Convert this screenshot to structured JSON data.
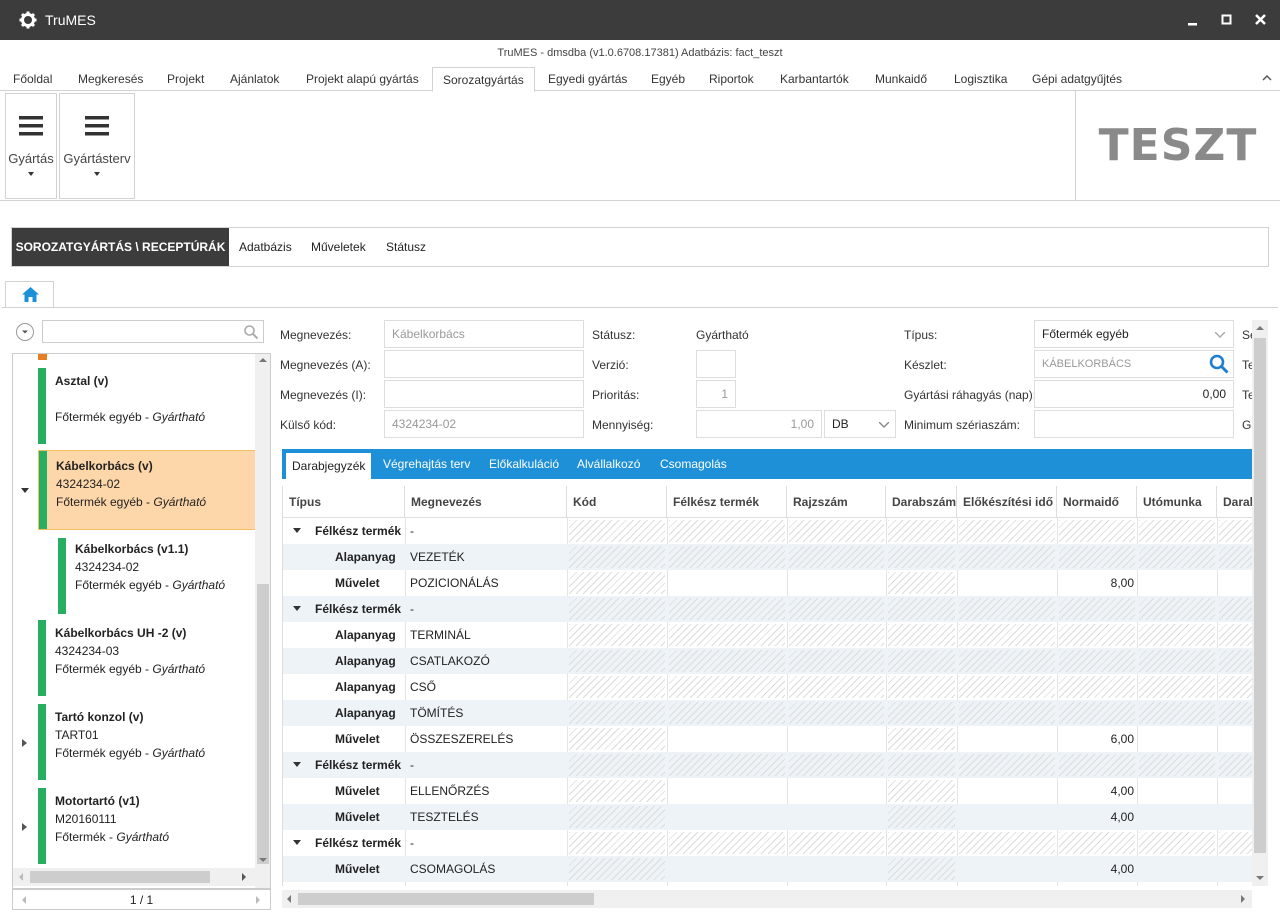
{
  "window": {
    "title": "TruMES",
    "subtitle": "TruMES - dmsdba (v1.0.6708.17381) Adatbázis: fact_teszt"
  },
  "menu_tabs": [
    "Főoldal",
    "Megkeresés",
    "Projekt",
    "Ajánlatok",
    "Projekt alapú gyártás",
    "Sorozatgyártás",
    "Egyedi gyártás",
    "Egyéb",
    "Riportok",
    "Karbantartók",
    "Munkaidő",
    "Logisztika",
    "Gépi adatgyűjtés"
  ],
  "active_menu_tab": "Sorozatgyártás",
  "ribbon": {
    "buttons": [
      "Gyártás",
      "Gyártásterv"
    ],
    "environment_label": "TESZT"
  },
  "module": {
    "breadcrumb": "SOROZATGYÁRTÁS \\ RECEPTÚRÁK",
    "items": [
      "Adatbázis",
      "Műveletek",
      "Státusz"
    ]
  },
  "tree": {
    "search_placeholder": "",
    "nodes": [
      {
        "title": "Asztal  (v)",
        "code": "",
        "type": "Főtermék egyéb",
        "status": "Gyártható"
      },
      {
        "title": "Kábelkorbács  (v)",
        "code": "4324234-02",
        "type": "Főtermék egyéb",
        "status": "Gyártható"
      },
      {
        "title": "Kábelkorbács  (v1.1)",
        "code": "4324234-02",
        "type": "Főtermék egyéb",
        "status": "Gyártható"
      },
      {
        "title": "Kábelkorbács UH -2  (v)",
        "code": "4324234-03",
        "type": "Főtermék egyéb",
        "status": "Gyártható"
      },
      {
        "title": "Tartó konzol  (v)",
        "code": "TART01",
        "type": "Főtermék egyéb",
        "status": "Gyártható"
      },
      {
        "title": "Motortartó  (v1)",
        "code": "M20160111",
        "type": "Főtermék",
        "status": "Gyártható"
      }
    ],
    "pager": "1 / 1"
  },
  "form": {
    "megnevezes_label": "Megnevezés:",
    "megnevezes_value": "Kábelkorbács",
    "megnevezes_a_label": "Megnevezés (A):",
    "megnevezes_i_label": "Megnevezés (I):",
    "kulso_kod_label": "Külső kód:",
    "kulso_kod_value": "4324234-02",
    "statusz_label": "Státusz:",
    "statusz_value": "Gyártható",
    "verzio_label": "Verzió:",
    "prioritas_label": "Prioritás:",
    "prioritas_value": "1",
    "mennyiseg_label": "Mennyiség:",
    "mennyiseg_value": "1,00",
    "mennyiseg_unit": "DB",
    "tipus_label": "Típus:",
    "tipus_value": "Főtermék egyéb",
    "keszlet_label": "Készlet:",
    "keszlet_value": "KÁBELKORBÁCS",
    "rahagyas_label": "Gyártási ráhagyás (nap):",
    "rahagyas_value": "0,00",
    "min_szeria_label": "Minimum szériaszám:",
    "cut_labels": [
      "Se",
      "Te",
      "Te",
      "G"
    ]
  },
  "sub_tabs": [
    "Darabjegyzék",
    "Végrehajtás terv",
    "Előkalkuláció",
    "Alvállalkozó",
    "Csomagolás"
  ],
  "active_sub_tab": "Darabjegyzék",
  "grid": {
    "columns": [
      "Típus",
      "Megnevezés",
      "Kód",
      "Félkész termék",
      "Rajzszám",
      "Darabszám",
      "Előkészítési idő",
      "Normaidő",
      "Utómunka",
      "Darab"
    ],
    "rows": [
      {
        "level": 0,
        "type": "Félkész termék",
        "name": "-",
        "norma": ""
      },
      {
        "level": 1,
        "type": "Alapanyag",
        "name": "VEZETÉK",
        "norma": ""
      },
      {
        "level": 1,
        "type": "Művelet",
        "name": "POZICIONÁLÁS",
        "norma": "8,00"
      },
      {
        "level": 0,
        "type": "Félkész termék",
        "name": "-",
        "norma": ""
      },
      {
        "level": 1,
        "type": "Alapanyag",
        "name": "TERMINÁL",
        "norma": ""
      },
      {
        "level": 1,
        "type": "Alapanyag",
        "name": "CSATLAKOZÓ",
        "norma": ""
      },
      {
        "level": 1,
        "type": "Alapanyag",
        "name": "CSŐ",
        "norma": ""
      },
      {
        "level": 1,
        "type": "Alapanyag",
        "name": "TÖMÍTÉS",
        "norma": ""
      },
      {
        "level": 1,
        "type": "Művelet",
        "name": "ÖSSZESZERELÉS",
        "norma": "6,00"
      },
      {
        "level": 0,
        "type": "Félkész termék",
        "name": "-",
        "norma": ""
      },
      {
        "level": 1,
        "type": "Művelet",
        "name": "ELLENŐRZÉS",
        "norma": "4,00"
      },
      {
        "level": 1,
        "type": "Művelet",
        "name": "TESZTELÉS",
        "norma": "4,00"
      },
      {
        "level": 0,
        "type": "Félkész termék",
        "name": "-",
        "norma": ""
      },
      {
        "level": 1,
        "type": "Művelet",
        "name": "CSOMAGOLÁS",
        "norma": "4,00"
      }
    ]
  },
  "colors": {
    "titlebar": "#3c3c3c",
    "accent_blue": "#1e90d8",
    "status_green": "#27ae60",
    "selected_bg": "#fdd7a9"
  }
}
